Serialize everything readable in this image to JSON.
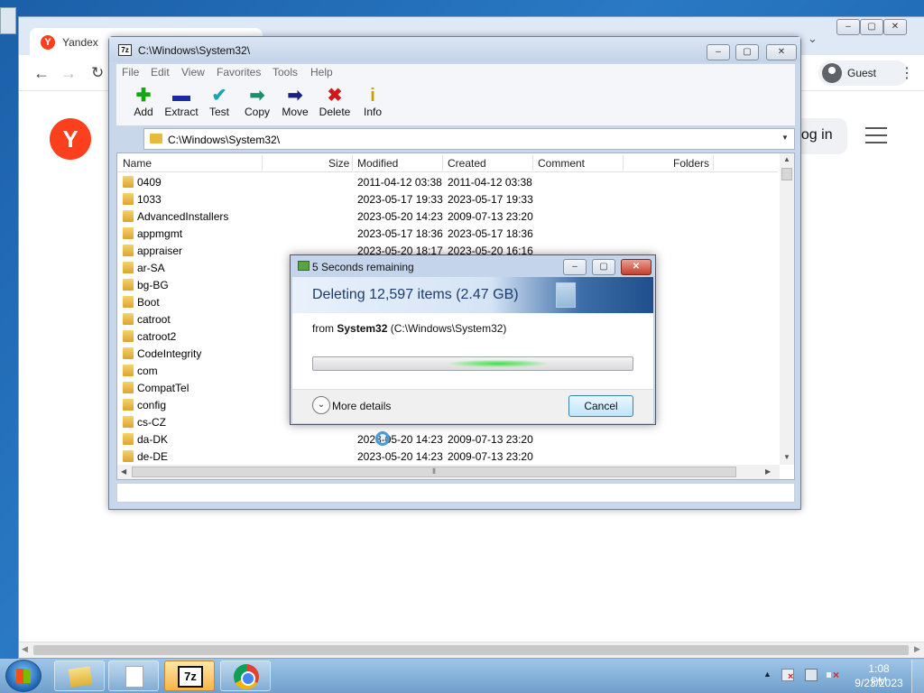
{
  "browser": {
    "tab_title": "Yandex",
    "profile_label": "Guest",
    "login_label": "Log in",
    "logo_letter": "Y"
  },
  "zip": {
    "title": "C:\\Windows\\System32\\",
    "menu": [
      "File",
      "Edit",
      "View",
      "Favorites",
      "Tools",
      "Help"
    ],
    "toolbar": [
      {
        "label": "Add",
        "icon": "plus-icon",
        "glyph": "✚",
        "color": "#1aa31a"
      },
      {
        "label": "Extract",
        "icon": "minus-icon",
        "glyph": "▬",
        "color": "#1a2aa8"
      },
      {
        "label": "Test",
        "icon": "check-icon",
        "glyph": "✔",
        "color": "#1aa6b0"
      },
      {
        "label": "Copy",
        "icon": "arrow-right-icon",
        "glyph": "➡",
        "color": "#1a8f6a"
      },
      {
        "label": "Move",
        "icon": "arrow-right-icon",
        "glyph": "➡",
        "color": "#1a2080"
      },
      {
        "label": "Delete",
        "icon": "delete-x-icon",
        "glyph": "✖",
        "color": "#d01818"
      },
      {
        "label": "Info",
        "icon": "info-icon",
        "glyph": "i",
        "color": "#c8a200"
      }
    ],
    "address": "C:\\Windows\\System32\\",
    "columns": {
      "name": "Name",
      "size": "Size",
      "modified": "Modified",
      "created": "Created",
      "comment": "Comment",
      "folders": "Folders"
    },
    "rows": [
      {
        "name": "0409",
        "modified": "2011-04-12 03:38",
        "created": "2011-04-12 03:38"
      },
      {
        "name": "1033",
        "modified": "2023-05-17 19:33",
        "created": "2023-05-17 19:33"
      },
      {
        "name": "AdvancedInstallers",
        "modified": "2023-05-20 14:23",
        "created": "2009-07-13 23:20"
      },
      {
        "name": "appmgmt",
        "modified": "2023-05-17 18:36",
        "created": "2023-05-17 18:36"
      },
      {
        "name": "appraiser",
        "modified": "2023-05-20 18:17",
        "created": "2023-05-20 16:16"
      },
      {
        "name": "ar-SA",
        "modified": "",
        "created": ""
      },
      {
        "name": "bg-BG",
        "modified": "",
        "created": ""
      },
      {
        "name": "Boot",
        "modified": "",
        "created": ""
      },
      {
        "name": "catroot",
        "modified": "",
        "created": ""
      },
      {
        "name": "catroot2",
        "modified": "",
        "created": ""
      },
      {
        "name": "CodeIntegrity",
        "modified": "",
        "created": ""
      },
      {
        "name": "com",
        "modified": "",
        "created": ""
      },
      {
        "name": "CompatTel",
        "modified": "",
        "created": ""
      },
      {
        "name": "config",
        "modified": "",
        "created": ""
      },
      {
        "name": "cs-CZ",
        "modified": "",
        "created": ""
      },
      {
        "name": "da-DK",
        "modified": "2023-05-20 14:23",
        "created": "2009-07-13 23:20"
      },
      {
        "name": "de-DE",
        "modified": "2023-05-20 14:23",
        "created": "2009-07-13 23:20"
      }
    ]
  },
  "dialog": {
    "title": "5 Seconds remaining",
    "heading": "Deleting 12,597 items (2.47 GB)",
    "from_prefix": "from",
    "from_bold": "System32",
    "from_path": "(C:\\Windows\\System32)",
    "more_details": "More details",
    "cancel": "Cancel",
    "progress": 0.5
  },
  "taskbar": {
    "clock_time": "1:08 PM",
    "clock_date": "9/23/2023",
    "zip_label": "7z"
  }
}
